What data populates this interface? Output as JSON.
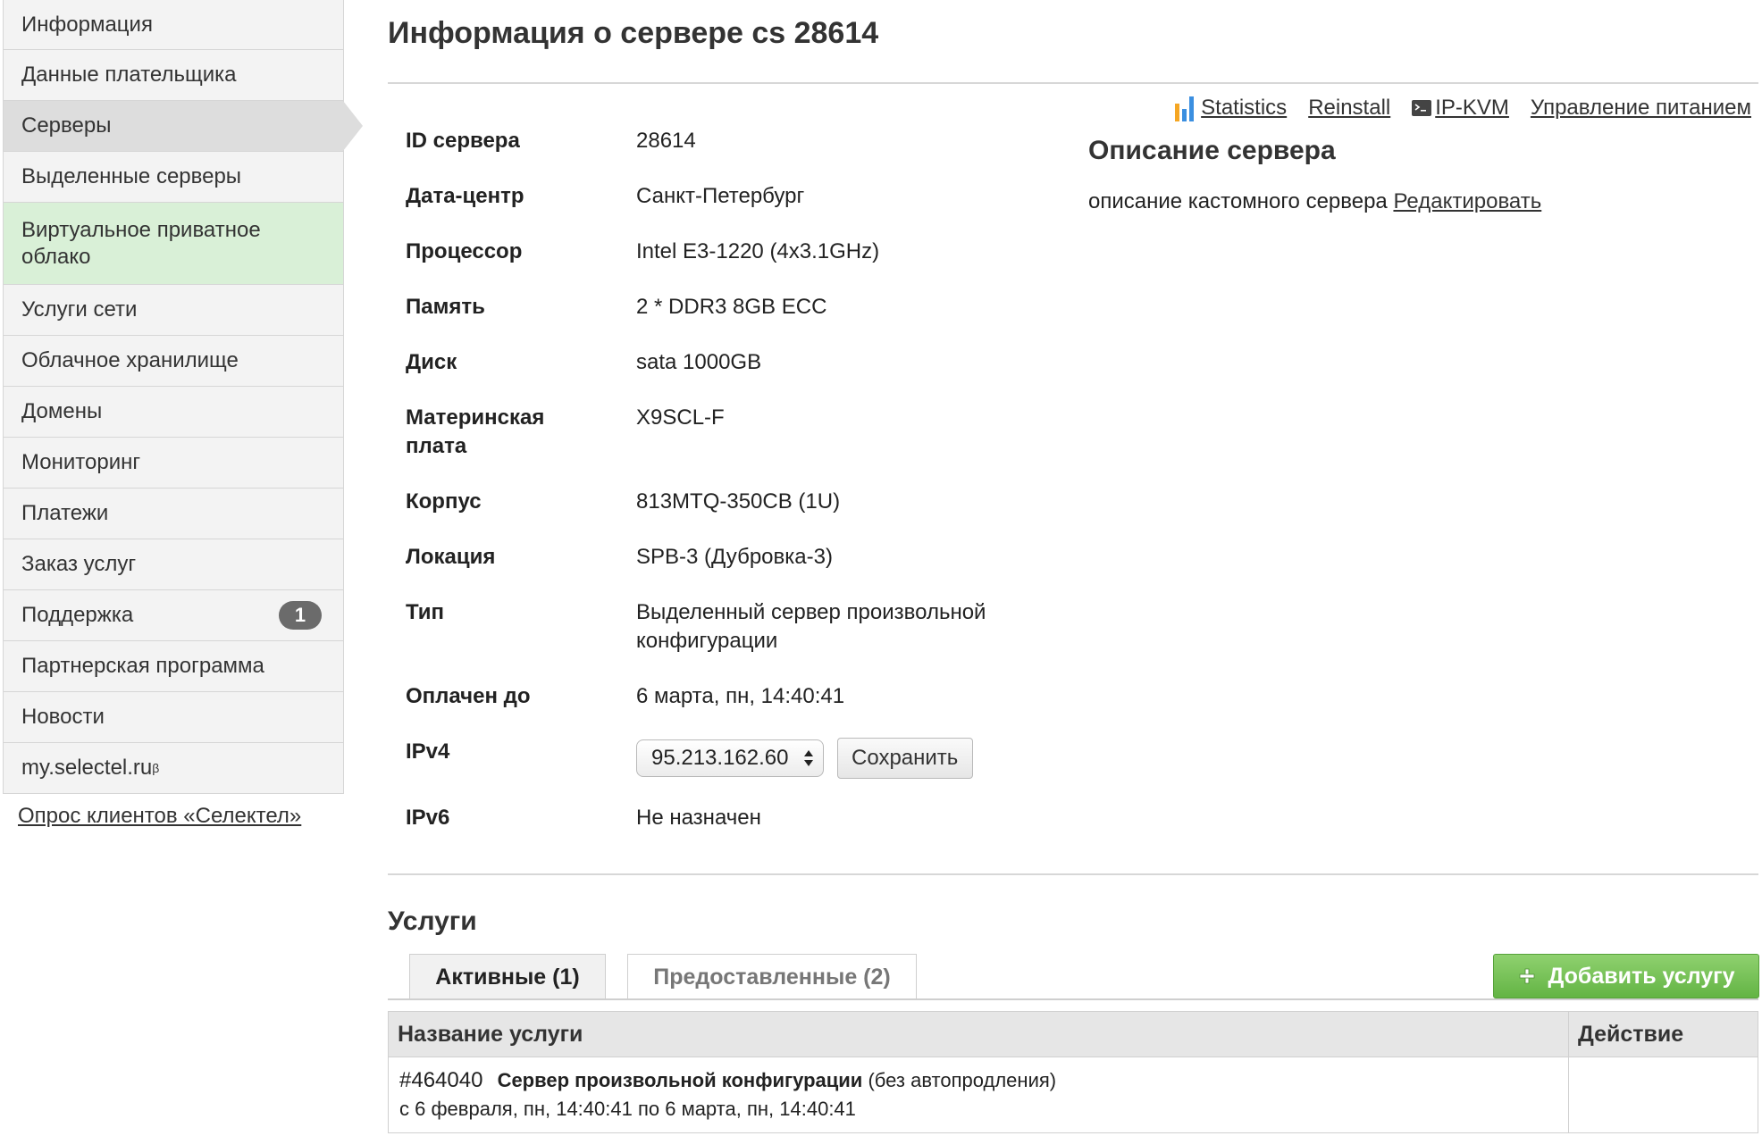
{
  "sidebar": {
    "items": [
      {
        "label": "Информация"
      },
      {
        "label": "Данные плательщика"
      },
      {
        "label": "Серверы"
      },
      {
        "label": "Выделенные серверы"
      },
      {
        "label": "Виртуальное приватное облако"
      },
      {
        "label": "Услуги сети"
      },
      {
        "label": "Облачное хранилище"
      },
      {
        "label": "Домены"
      },
      {
        "label": "Мониторинг"
      },
      {
        "label": "Платежи"
      },
      {
        "label": "Заказ услуг"
      },
      {
        "label": "Поддержка",
        "badge": "1"
      },
      {
        "label": "Партнерская программа"
      },
      {
        "label": "Новости"
      },
      {
        "label": "my.selectel.ru",
        "sup": "β"
      }
    ],
    "survey_link": "Опрос клиентов «Селектел»"
  },
  "page": {
    "title": "Информация о сервере cs 28614"
  },
  "toolbar": {
    "statistics": "Statistics",
    "reinstall": "Reinstall",
    "ipkvm": "IP-KVM",
    "power": "Управление питанием"
  },
  "specs": [
    {
      "label": "ID сервера",
      "value": "28614"
    },
    {
      "label": "Дата-центр",
      "value": "Санкт-Петербург"
    },
    {
      "label": "Процессор",
      "value": "Intel E3-1220 (4x3.1GHz)"
    },
    {
      "label": "Память",
      "value": "2 * DDR3 8GB ECC"
    },
    {
      "label": "Диск",
      "value": "sata 1000GB"
    },
    {
      "label": "Материнская плата",
      "value": "X9SCL-F"
    },
    {
      "label": "Корпус",
      "value": "813MTQ-350CB (1U)"
    },
    {
      "label": "Локация",
      "value": "SPB-3 (Дубровка-3)"
    },
    {
      "label": "Тип",
      "value": "Выделенный сервер произвольной конфигурации"
    },
    {
      "label": "Оплачен до",
      "value": "6 марта, пн, 14:40:41"
    },
    {
      "label": "IPv4"
    },
    {
      "label": "IPv6",
      "value": "Не назначен"
    }
  ],
  "ipv4": {
    "selected": "95.213.162.60",
    "save_label": "Сохранить"
  },
  "description": {
    "title": "Описание сервера",
    "text": "описание кастомного сервера",
    "edit_link": "Редактировать"
  },
  "services": {
    "title": "Услуги",
    "tabs": [
      {
        "label": "Активные (1)"
      },
      {
        "label": "Предоставленные (2)"
      }
    ],
    "add_button": "Добавить услугу",
    "columns": {
      "name": "Название услуги",
      "action": "Действие"
    },
    "rows": [
      {
        "id": "#464040",
        "name": "Сервер произвольной конфигурации",
        "note": "(без автопродления)",
        "period": "с 6 февраля, пн, 14:40:41 по 6 марта, пн, 14:40:41"
      }
    ]
  },
  "colors": {
    "active_green": "#d9f0d7",
    "add_button_green": "#6cbf4a",
    "badge_gray": "#6b6b6b"
  }
}
